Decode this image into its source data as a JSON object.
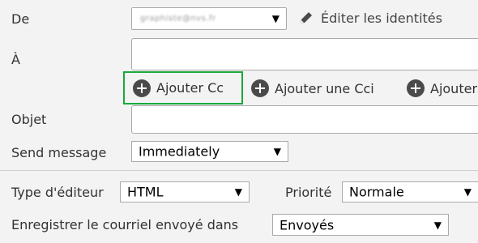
{
  "from": {
    "label": "De",
    "identity_value": "graphiste@nvs.fr",
    "edit_identities_label": "Éditer les identités",
    "edit_icon": "pencil-icon"
  },
  "to": {
    "label": "À",
    "add_cc_label": "Ajouter Cc",
    "add_bcc_label": "Ajouter une Cci",
    "add_followup_label": "Ajouter",
    "add_icon": "plus-circle-icon",
    "highlight_color": "#1aaa3c"
  },
  "subject": {
    "label": "Objet"
  },
  "send_message": {
    "label": "Send message",
    "value": "Immediately"
  },
  "editor_type": {
    "label": "Type d'éditeur",
    "value": "HTML"
  },
  "priority": {
    "label": "Priorité",
    "value": "Normale"
  },
  "save_sent": {
    "label": "Enregistrer le courriel envoyé dans",
    "value": "Envoyés"
  }
}
